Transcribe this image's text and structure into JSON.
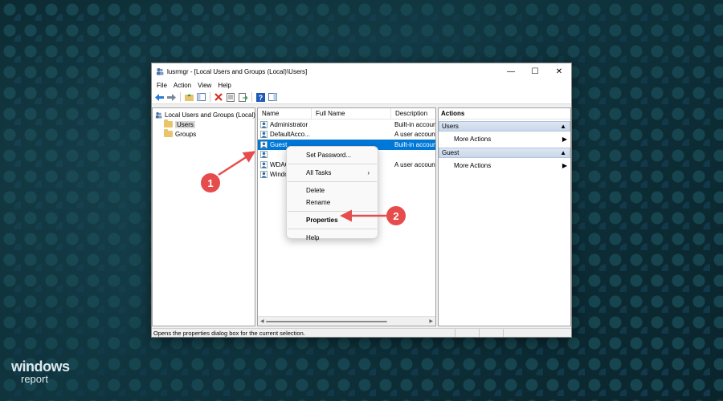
{
  "window": {
    "title": "lusrmgr - [Local Users and Groups (Local)\\Users]",
    "minimize": "—",
    "maximize": "☐",
    "close": "✕"
  },
  "menubar": [
    "File",
    "Action",
    "View",
    "Help"
  ],
  "tree": {
    "root": "Local Users and Groups (Local)",
    "children": [
      "Users",
      "Groups"
    ]
  },
  "list": {
    "columns": [
      "Name",
      "Full Name",
      "Description"
    ],
    "rows": [
      {
        "name": "Administrator",
        "full_name": "",
        "description": "Built-in accoun"
      },
      {
        "name": "DefaultAcco...",
        "full_name": "",
        "description": "A user account"
      },
      {
        "name": "Guest",
        "full_name": "",
        "description": "Built-in accoun"
      },
      {
        "name": "",
        "full_name": "",
        "description": ""
      },
      {
        "name": "WDAG",
        "full_name": "",
        "description": "A user account"
      },
      {
        "name": "Windo",
        "full_name": "",
        "description": ""
      }
    ]
  },
  "actions": {
    "title": "Actions",
    "sections": [
      {
        "label": "Users",
        "link": "More Actions"
      },
      {
        "label": "Guest",
        "link": "More Actions"
      }
    ]
  },
  "context_menu": {
    "set_password": "Set Password...",
    "all_tasks": "All Tasks",
    "delete": "Delete",
    "rename": "Rename",
    "properties": "Properties",
    "help": "Help"
  },
  "status": "Opens the properties dialog box for the current selection.",
  "badges": [
    "1",
    "2"
  ],
  "logo": {
    "line1": "windows",
    "line2": "report"
  },
  "colors": {
    "selection": "#0078d7",
    "badge": "#e74c4c",
    "desktop": "#0d2d36"
  }
}
